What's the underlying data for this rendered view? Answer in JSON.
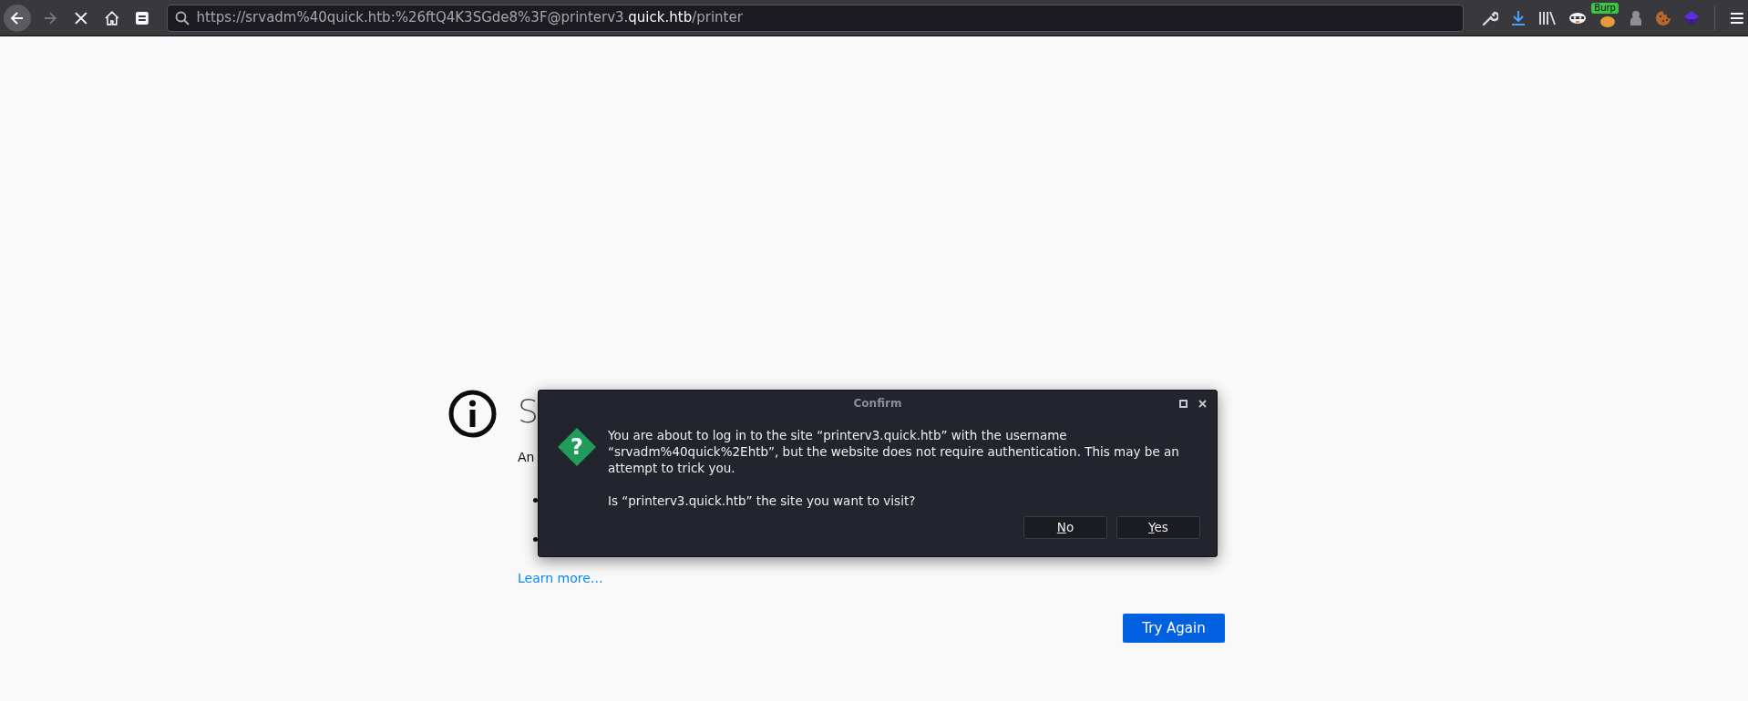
{
  "toolbar": {
    "url": {
      "prefix": "https://srvadm%40quick.htb:%26ftQ4K3SGde8%3F@printerv3.",
      "domain": "quick.htb",
      "suffix": "/printer"
    },
    "burp_badge": "Burp"
  },
  "error_page": {
    "heading": "S",
    "intro": "An",
    "learn_more": "Learn more…",
    "try_again": "Try Again"
  },
  "dialog": {
    "title": "Confirm",
    "message": "You are about to log in to the site “printerv3.quick.htb” with the username “srvadm%40quick%2Ehtb”, but the website does not require authentication. This may be an attempt to trick you.",
    "question": "Is “printerv3.quick.htb” the site you want to visit?",
    "icon": "?",
    "buttons": [
      {
        "accesskey": "N",
        "rest": "o"
      },
      {
        "accesskey": "Y",
        "rest": "es"
      }
    ]
  }
}
